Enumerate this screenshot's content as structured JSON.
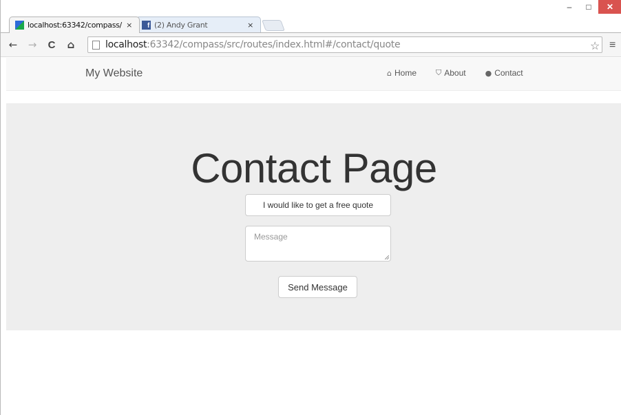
{
  "browser": {
    "tabs": [
      {
        "title": "localhost:63342/compass/",
        "favicon": "intellij-icon"
      },
      {
        "title": "(2) Andy Grant",
        "favicon": "facebook-icon"
      }
    ],
    "tab_close": "×",
    "window_controls": {
      "minimize": "–",
      "maximize": "□",
      "close": "✕"
    },
    "toolbar": {
      "back": "←",
      "forward": "→",
      "reload": "C",
      "home": "⌂"
    },
    "url": {
      "host": "localhost",
      "rest": ":63342/compass/src/routes/index.html#/contact/quote"
    },
    "star": "☆",
    "menu": "≡"
  },
  "site": {
    "brand": "My Website",
    "nav": [
      {
        "icon": "home-icon",
        "glyph": "⌂",
        "label": "Home"
      },
      {
        "icon": "shield-icon",
        "glyph": "⛉",
        "label": "About"
      },
      {
        "icon": "comment-icon",
        "glyph": "●",
        "label": "Contact"
      }
    ]
  },
  "main": {
    "title": "Contact Page",
    "quote_option": "I would like to get a free quote",
    "message_placeholder": "Message",
    "send_label": "Send Message"
  },
  "colors": {
    "jumbotron_bg": "#eeeeee",
    "navbar_bg": "#f8f8f8",
    "window_close": "#d9534f"
  }
}
